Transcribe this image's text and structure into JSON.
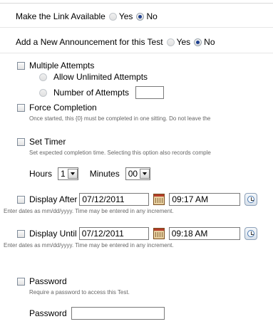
{
  "link_available": {
    "label": "Make the Link Available",
    "yes": "Yes",
    "no": "No",
    "selected": "No"
  },
  "announcement": {
    "label": "Add a New Announcement for this Test",
    "yes": "Yes",
    "no": "No",
    "selected": "No"
  },
  "multiple_attempts": {
    "label": "Multiple Attempts",
    "unlimited_label": "Allow Unlimited Attempts",
    "number_label": "Number of Attempts",
    "number_value": ""
  },
  "force_completion": {
    "label": "Force Completion",
    "help": "Once started, this {0} must be completed in one sitting. Do not leave the"
  },
  "set_timer": {
    "label": "Set Timer",
    "help": "Set expected completion time. Selecting this option also records comple",
    "hours_label": "Hours",
    "hours_value": "1",
    "minutes_label": "Minutes",
    "minutes_value": "00"
  },
  "display_after": {
    "label": "Display After",
    "date": "07/12/2011",
    "time": "09:17 AM",
    "help": "Enter dates as mm/dd/yyyy. Time may be entered in any increment."
  },
  "display_until": {
    "label": "Display Until",
    "date": "07/12/2011",
    "time": "09:18 AM",
    "help": "Enter dates as mm/dd/yyyy. Time may be entered in any increment."
  },
  "password": {
    "label": "Password",
    "help": "Require a password to access this Test.",
    "field_label": "Password",
    "value": ""
  }
}
